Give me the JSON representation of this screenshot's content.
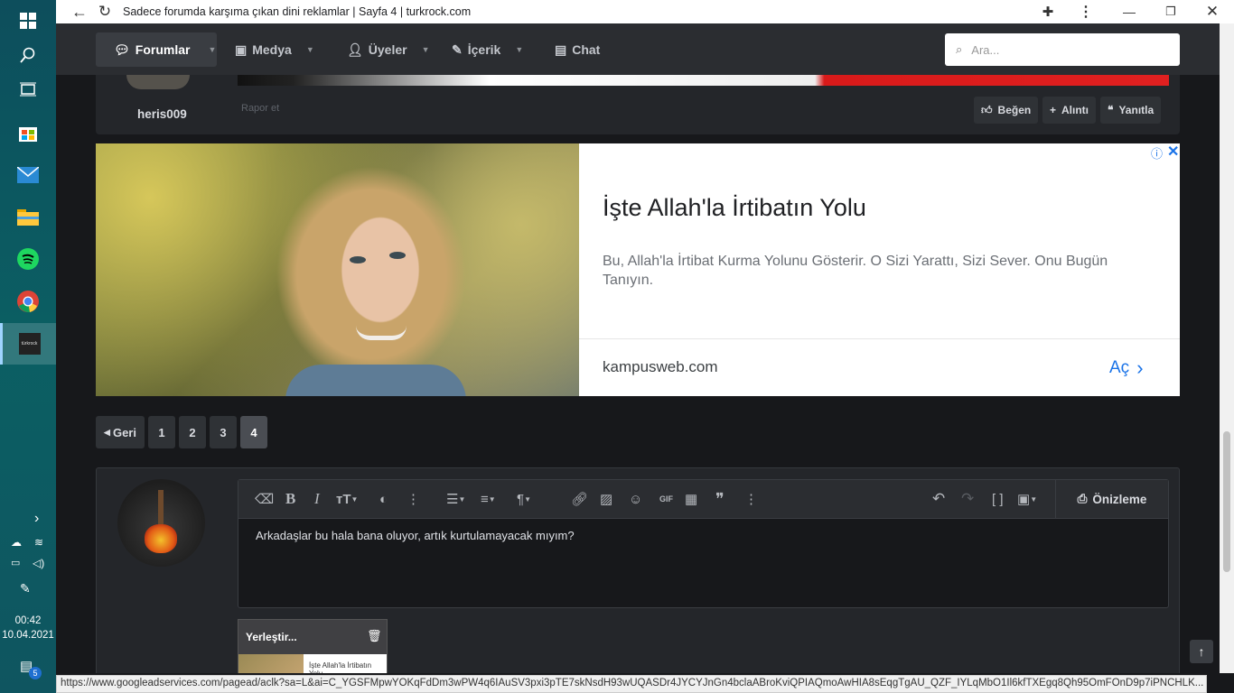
{
  "taskbar": {
    "clock_time": "00:42",
    "clock_date": "10.04.2021",
    "notification_count": "5",
    "active_app_label": "türkrock"
  },
  "browser": {
    "title": "Sadece forumda karşıma çıkan dini reklamlar | Sayfa 4 | turkrock.com",
    "status_url": "https://www.googleadservices.com/pagead/aclk?sa=L&ai=C_YGSFMpwYOKqFdDm3wPW4q6IAuSV3pxi3pTE7skNsdH93wUQASDr4JYCYJnGn4bclaABroKviQPIAQmoAwHIA8sEqgTgAU_QZF_IYLqMbO1Il6kfTXEgq8Qh95OmFOnD9p7iPNCHLK..."
  },
  "nav": {
    "items": [
      {
        "label": "Forumlar"
      },
      {
        "label": "Medya"
      },
      {
        "label": "Üyeler"
      },
      {
        "label": "İçerik"
      },
      {
        "label": "Chat"
      }
    ],
    "search_placeholder": "Ara..."
  },
  "post": {
    "username": "heris009",
    "report_label": "Rapor et",
    "like_label": "Beğen",
    "quote_label": "Alıntı",
    "reply_label": "Yanıtla"
  },
  "ad": {
    "title": "İşte Allah'la İrtibatın Yolu",
    "description": "Bu, Allah'la İrtibat Kurma Yolunu Gösterir. O Sizi Yarattı, Sizi Sever. Onu Bugün Tanıyın.",
    "url": "kampusweb.com",
    "open_label": "Aç"
  },
  "pagination": {
    "prev_label": "Geri",
    "pages": [
      "1",
      "2",
      "3",
      "4"
    ],
    "current": "4"
  },
  "editor": {
    "text": "Arkadaşlar bu hala bana oluyor, artık kurtulamayacak mıyım?",
    "preview_label": "Önizleme",
    "attachment_label": "Yerleştir...",
    "attachment_thumb_text": "İşte Allah'la İrtibatın Yolu"
  }
}
